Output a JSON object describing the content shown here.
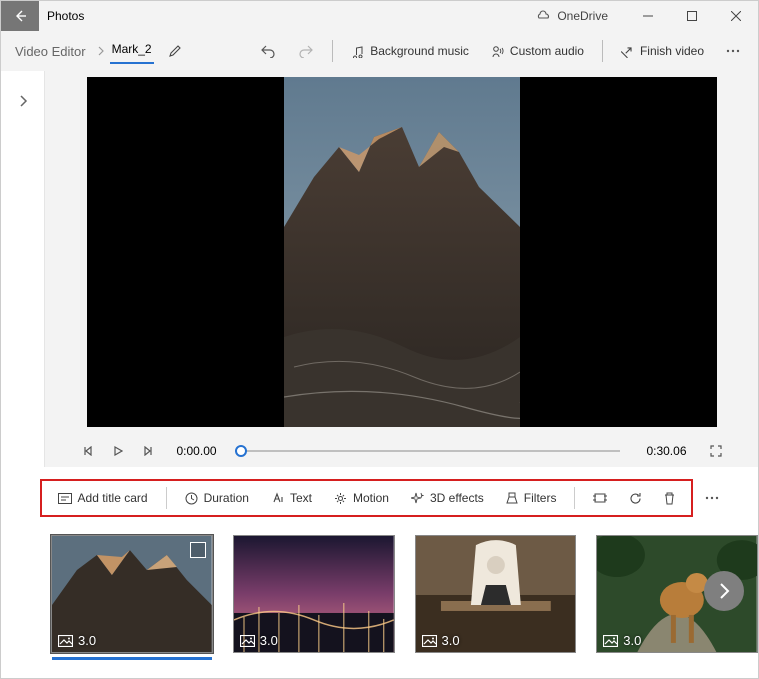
{
  "titlebar": {
    "app_name": "Photos",
    "onedrive": "OneDrive"
  },
  "breadcrumbs": {
    "root": "Video Editor",
    "current": "Mark_2"
  },
  "commands": {
    "background_music": "Background music",
    "custom_audio": "Custom audio",
    "finish_video": "Finish video"
  },
  "playback": {
    "current": "0:00.00",
    "total": "0:30.06"
  },
  "edit_toolbar": {
    "add_title_card": "Add title card",
    "duration": "Duration",
    "text": "Text",
    "motion": "Motion",
    "three_d": "3D effects",
    "filters": "Filters"
  },
  "clips": [
    {
      "duration": "3.0"
    },
    {
      "duration": "3.0"
    },
    {
      "duration": "3.0"
    },
    {
      "duration": "3.0"
    }
  ]
}
